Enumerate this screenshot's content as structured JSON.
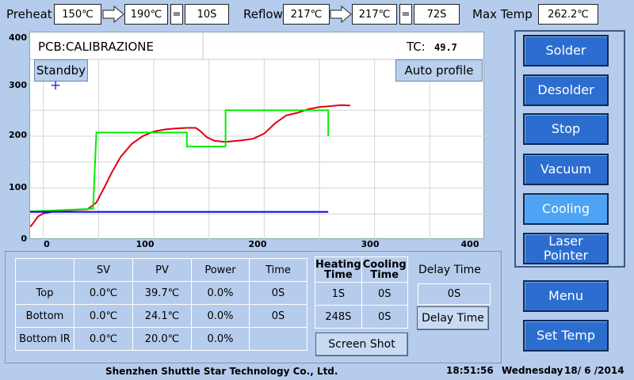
{
  "top_bar": {
    "preheat_label": "Preheat",
    "preheat_start": "150℃",
    "preheat_end": "190℃",
    "preheat_time": "10S",
    "reflow_label": "Reflow",
    "reflow_start": "217℃",
    "reflow_end": "217℃",
    "reflow_time": "72S",
    "max_temp_label": "Max Temp",
    "max_temp_value": "262.2℃",
    "equals": "="
  },
  "chart_panel": {
    "pcb_label": "PCB:CALIBRAZIONE",
    "tc_label": "TC:",
    "tc_value": "49.7",
    "standby_button": "Standby",
    "auto_profile_button": "Auto profile",
    "cursor_marker": "+"
  },
  "chart_data": {
    "type": "line",
    "xlim": [
      -12,
      400
    ],
    "ylim": [
      0,
      400
    ],
    "x_ticks": [
      "0",
      "100",
      "200",
      "300",
      "400"
    ],
    "y_ticks": [
      "0",
      "100",
      "200",
      "300",
      "400"
    ],
    "grid": true,
    "series": [
      {
        "color": "#e00010",
        "points": [
          [
            -12,
            25
          ],
          [
            -10,
            30
          ],
          [
            -5,
            45
          ],
          [
            0,
            51
          ],
          [
            10,
            55
          ],
          [
            20,
            57
          ],
          [
            30,
            58
          ],
          [
            40,
            59
          ],
          [
            48,
            72
          ],
          [
            55,
            100
          ],
          [
            62,
            130
          ],
          [
            70,
            160
          ],
          [
            80,
            185
          ],
          [
            90,
            200
          ],
          [
            100,
            209
          ],
          [
            110,
            213
          ],
          [
            120,
            215
          ],
          [
            130,
            216
          ],
          [
            138,
            216
          ],
          [
            142,
            210
          ],
          [
            148,
            198
          ],
          [
            155,
            191
          ],
          [
            165,
            189
          ],
          [
            180,
            192
          ],
          [
            190,
            195
          ],
          [
            200,
            205
          ],
          [
            210,
            225
          ],
          [
            220,
            240
          ],
          [
            230,
            245
          ],
          [
            240,
            252
          ],
          [
            250,
            256
          ],
          [
            260,
            258
          ],
          [
            270,
            260
          ],
          [
            278,
            259
          ]
        ]
      },
      {
        "color": "#00ee00",
        "points": [
          [
            -12,
            55
          ],
          [
            45,
            60
          ],
          [
            48,
            207
          ],
          [
            130,
            207
          ],
          [
            130,
            180
          ],
          [
            165,
            180
          ],
          [
            165,
            250
          ],
          [
            258,
            250
          ],
          [
            258,
            200
          ]
        ]
      },
      {
        "color": "#0000ee",
        "points": [
          [
            -12,
            54
          ],
          [
            258,
            54
          ]
        ]
      }
    ]
  },
  "right_panel": {
    "solder": "Solder",
    "desolder": "Desolder",
    "stop": "Stop",
    "vacuum": "Vacuum",
    "cooling": "Cooling",
    "laser_pointer_line1": "Laser",
    "laser_pointer_line2": "Pointer",
    "menu": "Menu",
    "set_temp": "Set Temp"
  },
  "data_table": {
    "headers": [
      "SV",
      "PV",
      "Power",
      "Time"
    ],
    "rows": [
      {
        "name": "Top",
        "sv": "0.0℃",
        "pv": "39.7℃",
        "power": "0.0%",
        "time": "0S"
      },
      {
        "name": "Bottom",
        "sv": "0.0℃",
        "pv": "24.1℃",
        "power": "0.0%",
        "time": "0S"
      },
      {
        "name": "Bottom IR",
        "sv": "0.0℃",
        "pv": "20.0℃",
        "power": "0.0%",
        "time": ""
      }
    ],
    "heating_time_label_line1": "Heating",
    "heating_time_label_line2": "Time",
    "cooling_time_label_line1": "Cooling",
    "cooling_time_label_line2": "Time",
    "heating_cooling_rows": [
      {
        "heating": "1S",
        "cooling": "0S"
      },
      {
        "heating": "248S",
        "cooling": "0S"
      }
    ],
    "delay_time_label": "Delay Time",
    "delay_time_value": "0S",
    "delay_time_button": "Delay Time",
    "screen_shot_button": "Screen Shot"
  },
  "footer": {
    "company": "Shenzhen Shuttle Star Technology Co., Ltd.",
    "time": "18:51:56",
    "day": "Wednesday",
    "date": "18/ 6 /2014"
  }
}
